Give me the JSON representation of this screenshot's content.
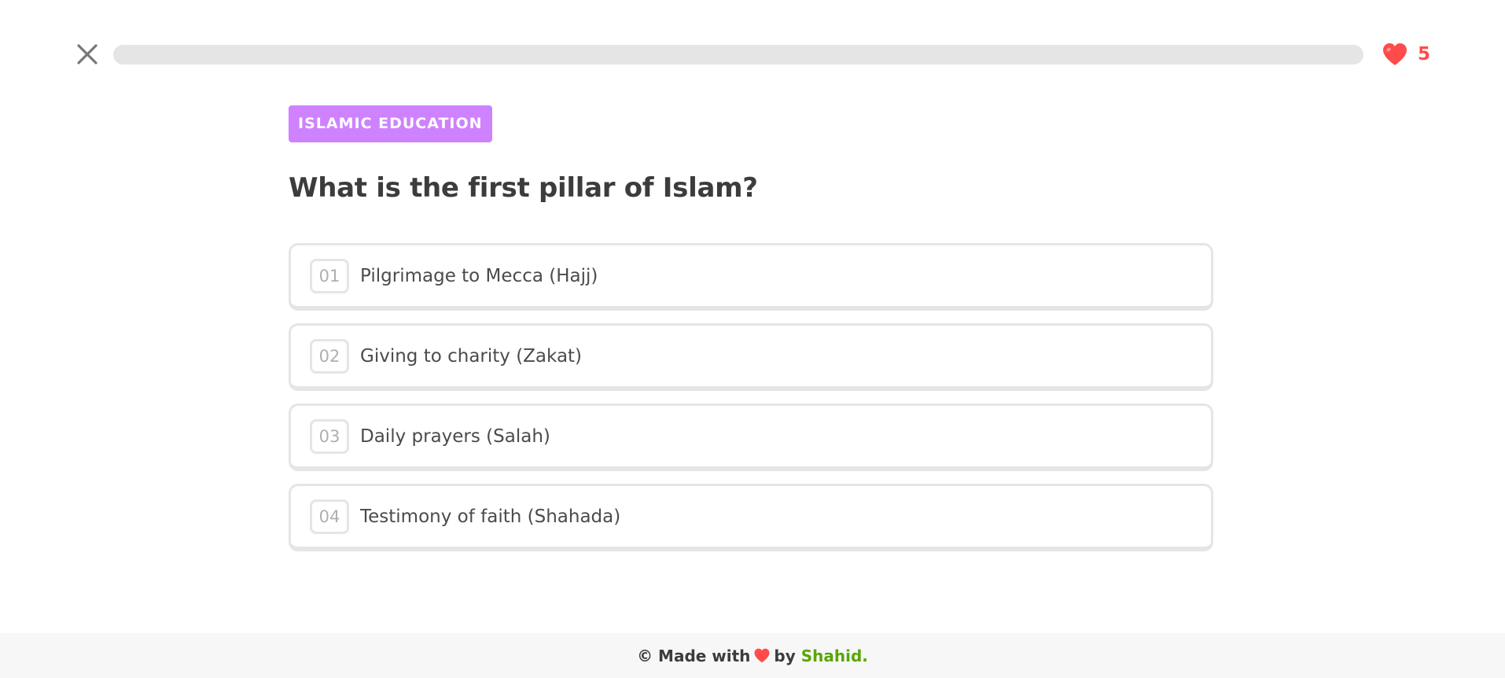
{
  "header": {
    "close_icon": "close-icon",
    "progress_percent": 0,
    "hearts_count": "5",
    "hearts_icon": "heart-icon",
    "colors": {
      "progress_track": "#e5e5e5",
      "hearts": "#ff4b4b"
    }
  },
  "question": {
    "category": "ISLAMIC EDUCATION",
    "text": "What is the first pillar of Islam?",
    "category_color": "#ce82ff"
  },
  "options": [
    {
      "number": "01",
      "label": "Pilgrimage to Mecca (Hajj)"
    },
    {
      "number": "02",
      "label": "Giving to charity (Zakat)"
    },
    {
      "number": "03",
      "label": "Daily prayers (Salah)"
    },
    {
      "number": "04",
      "label": "Testimony of faith (Shahada)"
    }
  ],
  "footer": {
    "prefix": "© Made with",
    "by": "by",
    "author": "Shahid.",
    "author_color": "#58a700",
    "heart_icon": "heart-icon"
  }
}
